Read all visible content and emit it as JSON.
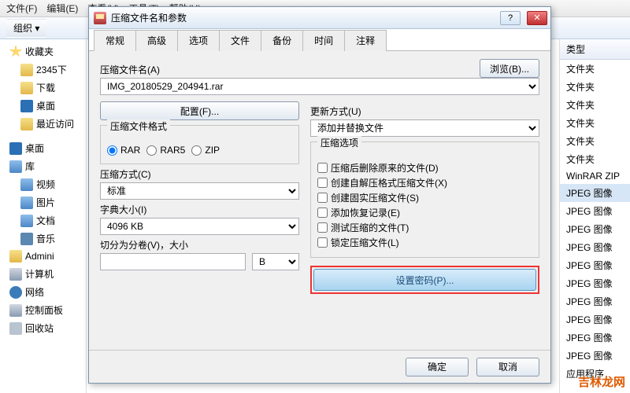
{
  "menubar": {
    "file": "文件(F)",
    "edit": "编辑(E)",
    "view": "查看(V)",
    "tools": "工具(T)",
    "help": "帮助(H)"
  },
  "toolbar": {
    "organize": "组织 ▾"
  },
  "tree": {
    "favorites": "收藏夹",
    "items": [
      "2345下",
      "下载",
      "桌面",
      "最近访问"
    ],
    "desktop": "桌面",
    "libraries": "库",
    "lib_items": [
      "视频",
      "图片",
      "文档",
      "音乐"
    ],
    "admin": "Admini",
    "computer": "计算机",
    "network": "网络",
    "controlpanel": "控制面板",
    "recyclebin": "回收站"
  },
  "typecol": {
    "header": "类型",
    "rows": [
      "文件夹",
      "文件夹",
      "文件夹",
      "文件夹",
      "文件夹",
      "文件夹",
      "WinRAR ZIP",
      "JPEG 图像",
      "JPEG 图像",
      "JPEG 图像",
      "JPEG 图像",
      "JPEG 图像",
      "JPEG 图像",
      "JPEG 图像",
      "JPEG 图像",
      "JPEG 图像",
      "JPEG 图像",
      "应用程序"
    ],
    "selected_index": 7
  },
  "dialog": {
    "title": "压缩文件名和参数",
    "tabs": [
      "常规",
      "高级",
      "选项",
      "文件",
      "备份",
      "时间",
      "注释"
    ],
    "active_tab": 0,
    "archive_name_label": "压缩文件名(A)",
    "archive_name_value": "IMG_20180529_204941.rar",
    "browse_btn": "浏览(B)...",
    "profiles_btn": "配置(F)...",
    "update_mode_label": "更新方式(U)",
    "update_mode_value": "添加并替换文件",
    "format_legend": "压缩文件格式",
    "formats": [
      "RAR",
      "RAR5",
      "ZIP"
    ],
    "format_selected": 0,
    "method_label": "压缩方式(C)",
    "method_value": "标准",
    "dict_label": "字典大小(I)",
    "dict_value": "4096 KB",
    "split_label": "切分为分卷(V)，大小",
    "split_value": "",
    "split_unit": "B",
    "options_legend": "压缩选项",
    "options": [
      "压缩后删除原来的文件(D)",
      "创建自解压格式压缩文件(X)",
      "创建固实压缩文件(S)",
      "添加恢复记录(E)",
      "测试压缩的文件(T)",
      "锁定压缩文件(L)"
    ],
    "password_btn": "设置密码(P)...",
    "ok": "确定",
    "cancel": "取消"
  },
  "watermark": "吉林龙网"
}
